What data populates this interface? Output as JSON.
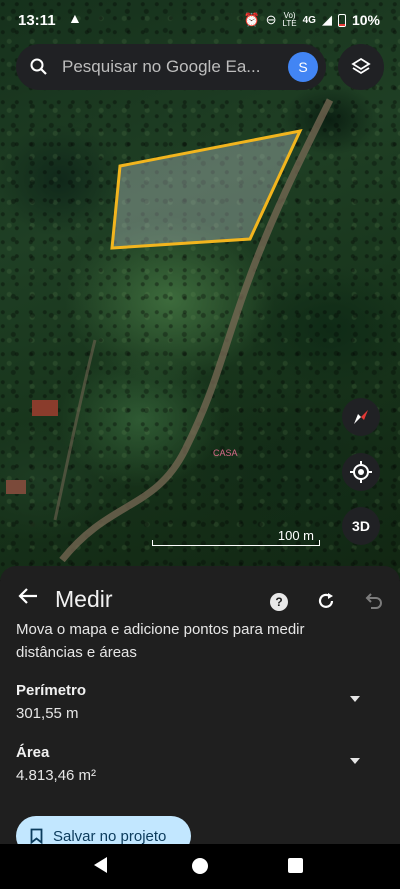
{
  "status_bar": {
    "time": "13:11",
    "network_top": "Vo)",
    "network_bottom": "LTE",
    "signal_type": "4G",
    "battery": "10%",
    "icons": [
      "alert-icon",
      "alarm-icon",
      "dnd-icon",
      "signal-icon",
      "battery-icon"
    ]
  },
  "search": {
    "placeholder": "Pesquisar no Google Ea...",
    "avatar_letter": "S"
  },
  "map": {
    "scale_label": "100 m",
    "place_label": "CASA",
    "three_d_label": "3D",
    "polygon_color": "#f2b51e"
  },
  "measure_panel": {
    "title": "Medir",
    "instruction": "Mova o mapa e adicione pontos para medir distâncias e áreas",
    "perimeter_label": "Perímetro",
    "perimeter_value": "301,55 m",
    "area_label": "Área",
    "area_value": "4.813,46 m²",
    "save_button": "Salvar no projeto"
  },
  "colors": {
    "panel_bg": "#1f1f1f",
    "save_button_bg": "#c2e7ff",
    "avatar_bg": "#4285f4"
  }
}
